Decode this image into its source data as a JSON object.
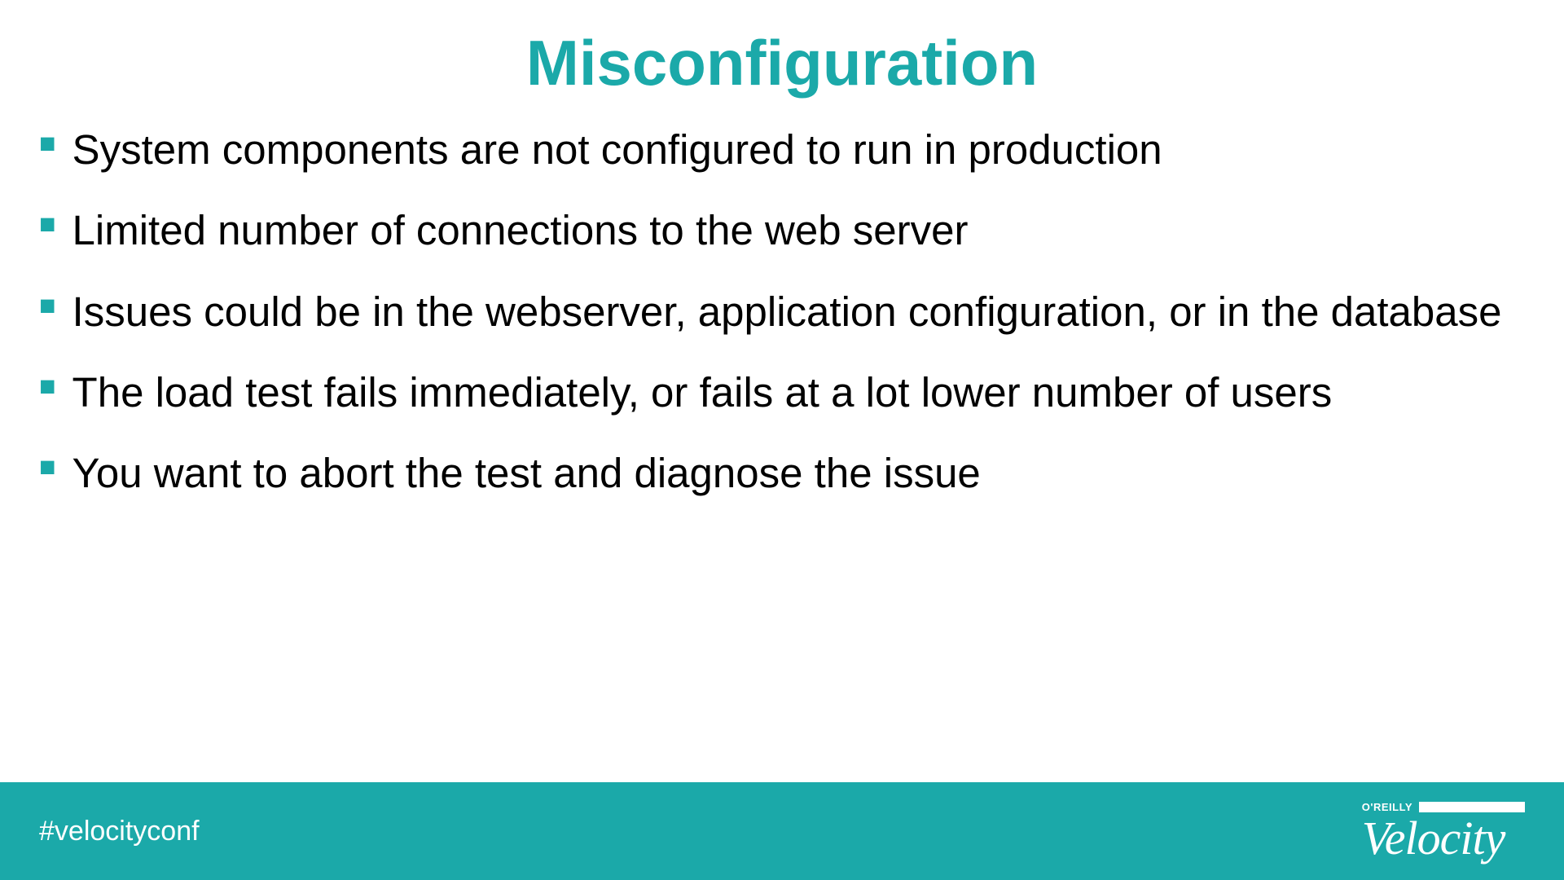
{
  "title": "Misconfiguration",
  "bullets": [
    "System components are not configured to run in production",
    "Limited number of connections to the web server",
    "Issues could be in the webserver, application configuration, or in the database",
    "The load test fails immediately, or fails at a lot lower number of users",
    "You want to abort the test and diagnose the issue"
  ],
  "footer": {
    "hashtag": "#velocityconf",
    "brand_small": "O'REILLY",
    "brand_main": "Velocity"
  },
  "colors": {
    "accent": "#1ba9a9",
    "text": "#000000",
    "footer_text": "#ffffff"
  }
}
